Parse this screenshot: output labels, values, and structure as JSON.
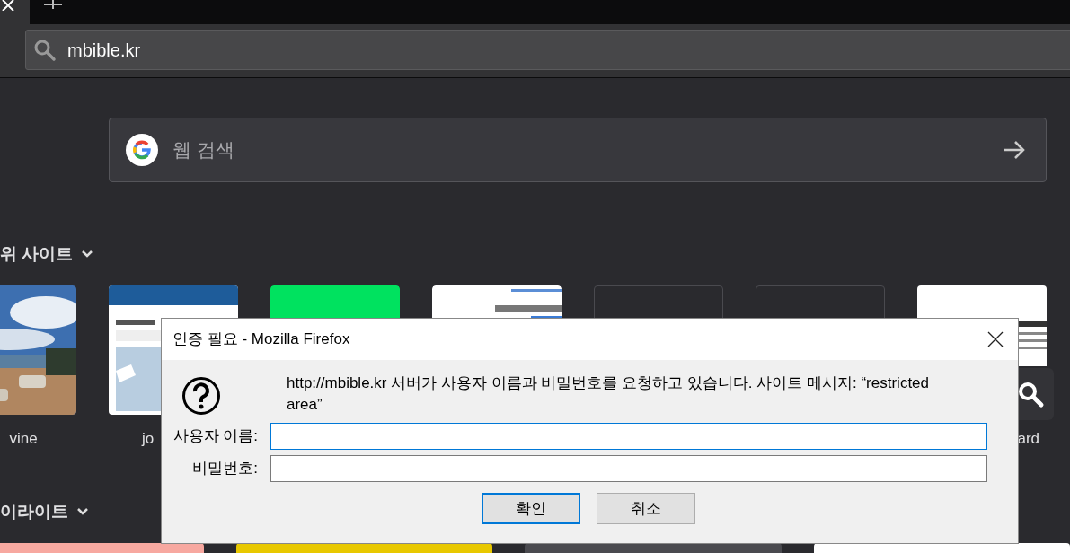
{
  "address_bar": {
    "value": "mbible.kr"
  },
  "search": {
    "placeholder": "웹 검색"
  },
  "top_sites": {
    "heading": "위 사이트",
    "tiles": [
      {
        "label": "vine"
      },
      {
        "kind": "journey",
        "label": "jo"
      },
      {
        "kind": "green"
      },
      {
        "kind": "doc"
      },
      {
        "kind": "empty"
      },
      {
        "kind": "empty"
      },
      {
        "kind": "search",
        "label": "ard"
      }
    ]
  },
  "highlights": {
    "heading": "이라이트",
    "cards": [
      {
        "color": "#f7a8a0"
      },
      {
        "color": "#e8c800"
      },
      {
        "color": "#4a4a4f"
      },
      {
        "color": "#ffffff"
      }
    ]
  },
  "dialog": {
    "title": "인증 필요 - Mozilla Firefox",
    "message": "http://mbible.kr 서버가 사용자 이름과 비밀번호를 요청하고 있습니다. 사이트 메시지: “restricted area”",
    "fields": [
      {
        "label": "사용자 이름:",
        "focused": true
      },
      {
        "label": "비밀번호:",
        "focused": false
      }
    ],
    "buttons": [
      {
        "label": "확인",
        "default": true
      },
      {
        "label": "취소",
        "default": false
      }
    ]
  }
}
